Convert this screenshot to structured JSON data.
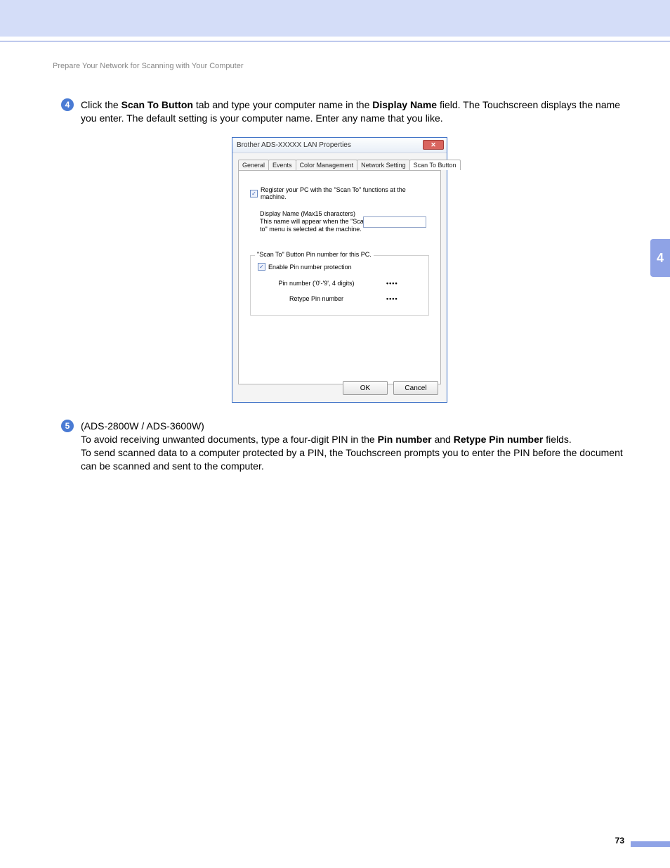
{
  "header": "Prepare Your Network for Scanning with Your Computer",
  "side_chapter": "4",
  "page_number": "73",
  "step4": {
    "num": "4",
    "t1": "Click the ",
    "b1": "Scan To Button",
    "t2": " tab and type your computer name in the ",
    "b2": "Display Name",
    "t3": " field. The Touchscreen displays the name you enter. The default setting is your computer name. Enter any name that you like."
  },
  "step5": {
    "num": "5",
    "l1": "(ADS-2800W / ADS-3600W)",
    "l2a": "To avoid receiving unwanted documents, type a four-digit PIN in the ",
    "l2b1": "Pin number",
    "l2c": " and ",
    "l2b2": "Retype Pin number",
    "l2d": " fields.",
    "l3": "To send scanned data to a computer protected by a PIN, the Touchscreen prompts you to enter the PIN before the document can be scanned and sent to the computer."
  },
  "dialog": {
    "title": "Brother ADS-XXXXX LAN Properties",
    "close_glyph": "✕",
    "tabs": {
      "general": "General",
      "events": "Events",
      "color": "Color Management",
      "network": "Network Setting",
      "scanto": "Scan To Button"
    },
    "register_label": "Register your PC with the \"Scan To\" functions at the machine.",
    "display_label": "Display Name (Max15 characters)\nThis name will appear when the \"Scan to\" menu is selected at the machine.",
    "display_value": "",
    "fieldset_legend": "\"Scan To\" Button Pin number for this PC.",
    "enable_label": "Enable Pin number protection",
    "pin_label": "Pin number ('0'-'9', 4 digits)",
    "retype_label": "Retype Pin number",
    "pin_dots": "••••",
    "ok": "OK",
    "cancel": "Cancel",
    "checkmark": "✓"
  }
}
